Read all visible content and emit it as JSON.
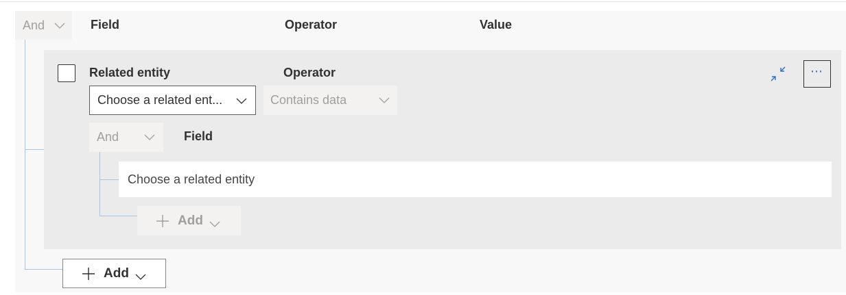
{
  "outer": {
    "logic": "And",
    "headers": {
      "field": "Field",
      "operator": "Operator",
      "value": "Value"
    },
    "add_label": "Add"
  },
  "group": {
    "related_entity_label": "Related entity",
    "operator_label": "Operator",
    "related_entity_select": {
      "value": "Choose a related ent..."
    },
    "operator_select": {
      "value": "Contains data"
    },
    "inner_logic": "And",
    "inner_field_header": "Field",
    "row_placeholder": "Choose a related entity",
    "inner_add_label": "Add"
  },
  "icons": {
    "collapse": "collapse-icon",
    "more": "more-icon",
    "chevron": "chevron-down-icon",
    "add": "plus-icon"
  },
  "colors": {
    "accent": "#2b6ccd",
    "tree_line": "#a9c3e8",
    "group_bg": "#ebebeb",
    "disabled_text": "#a19f9d"
  }
}
